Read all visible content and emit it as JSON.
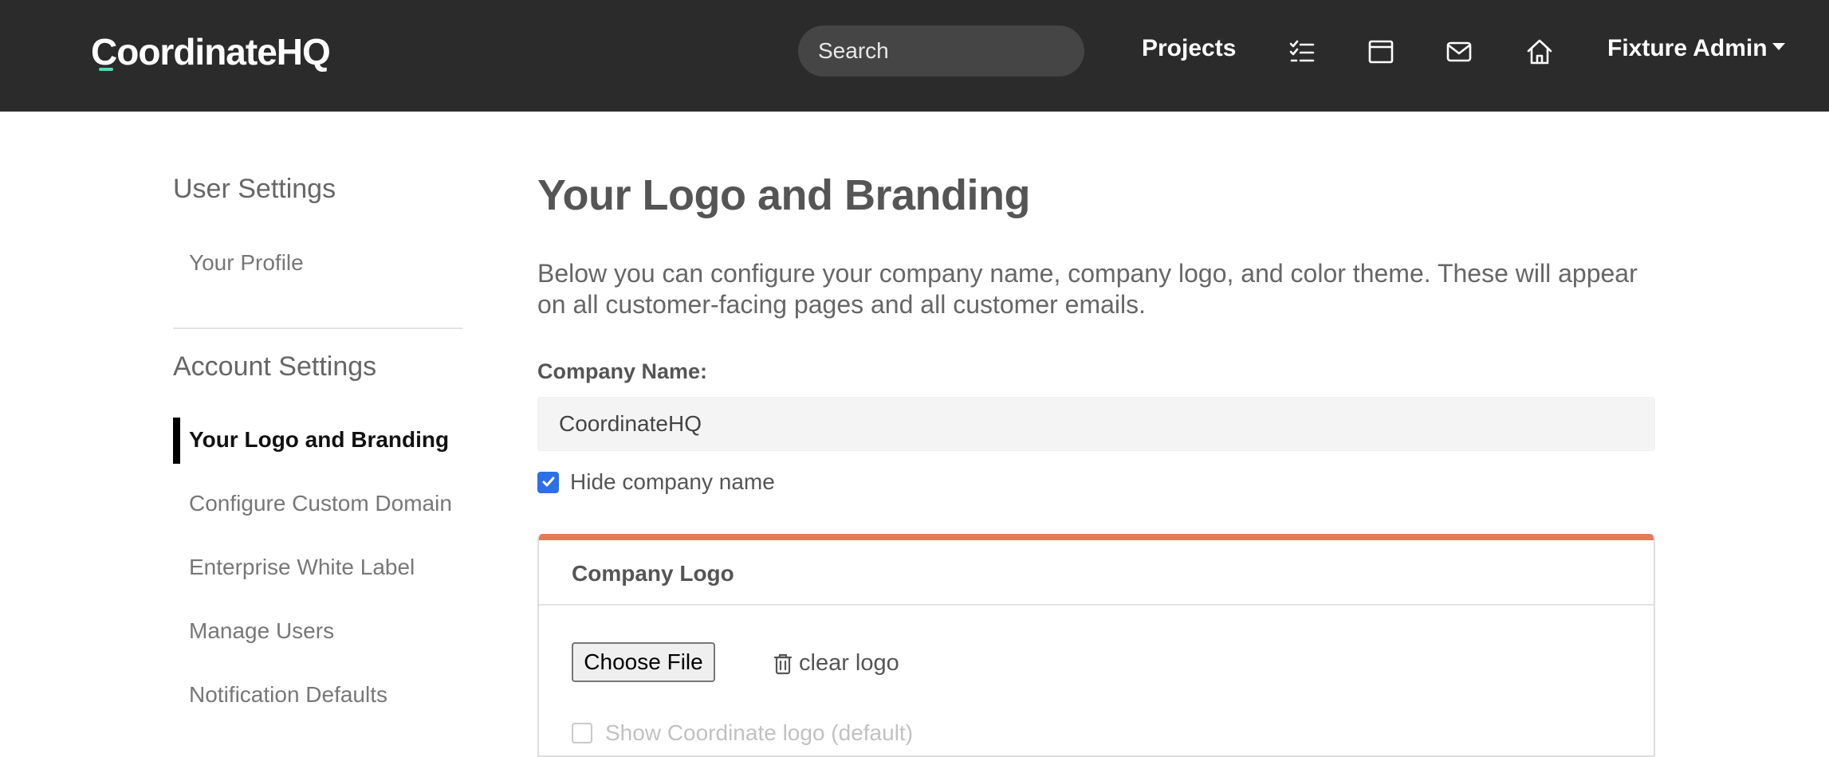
{
  "navbar": {
    "logo_text": "CoordinateHQ",
    "search_placeholder": "Search",
    "projects_label": "Projects",
    "icons": [
      "tasks-icon",
      "calendar-icon",
      "mail-icon",
      "home-icon"
    ],
    "user_name": "Fixture Admin"
  },
  "sidebar": {
    "user_heading": "User Settings",
    "user_items": [
      {
        "label": "Your Profile"
      }
    ],
    "account_heading": "Account Settings",
    "account_items": [
      {
        "label": "Your Logo and Branding",
        "active": true
      },
      {
        "label": "Configure Custom Domain"
      },
      {
        "label": "Enterprise White Label"
      },
      {
        "label": "Manage Users"
      },
      {
        "label": "Notification Defaults"
      }
    ]
  },
  "main": {
    "title": "Your Logo and Branding",
    "intro": "Below you can configure your company name, company logo, and color theme. These will appear on all customer-facing pages and all customer emails.",
    "company_name_label": "Company Name:",
    "company_name_value": "CoordinateHQ",
    "hide_company_name_label": "Hide company name",
    "hide_company_name_checked": true,
    "logo_card": {
      "title": "Company Logo",
      "choose_file_label": "Choose File",
      "clear_logo_label": "clear logo",
      "show_default_label": "Show Coordinate logo (default)"
    }
  },
  "colors": {
    "navbar_bg": "#2b2b2b",
    "card_accent": "#e27b5a",
    "checkbox_blue": "#2f6fe4"
  }
}
